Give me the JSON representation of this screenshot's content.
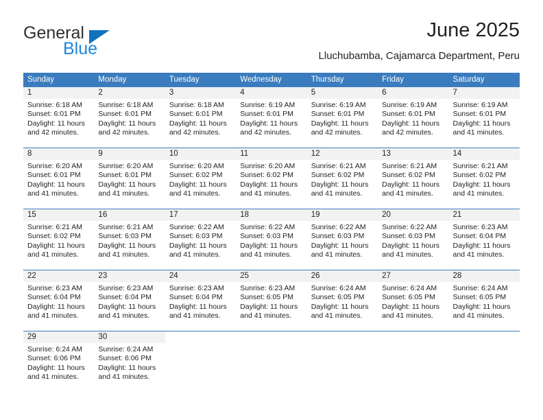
{
  "brand": {
    "name_part1": "General",
    "name_part2": "Blue"
  },
  "header": {
    "title": "June 2025",
    "subtitle": "Lluchubamba, Cajamarca Department, Peru"
  },
  "colors": {
    "header_blue": "#3a7cbe",
    "band_gray": "#f2f2f2",
    "logo_blue": "#1f86d8",
    "text": "#222222"
  },
  "weekdays": [
    "Sunday",
    "Monday",
    "Tuesday",
    "Wednesday",
    "Thursday",
    "Friday",
    "Saturday"
  ],
  "weeks": [
    [
      {
        "day": "1",
        "sunrise": "Sunrise: 6:18 AM",
        "sunset": "Sunset: 6:01 PM",
        "daylight_line1": "Daylight: 11 hours",
        "daylight_line2": "and 42 minutes."
      },
      {
        "day": "2",
        "sunrise": "Sunrise: 6:18 AM",
        "sunset": "Sunset: 6:01 PM",
        "daylight_line1": "Daylight: 11 hours",
        "daylight_line2": "and 42 minutes."
      },
      {
        "day": "3",
        "sunrise": "Sunrise: 6:18 AM",
        "sunset": "Sunset: 6:01 PM",
        "daylight_line1": "Daylight: 11 hours",
        "daylight_line2": "and 42 minutes."
      },
      {
        "day": "4",
        "sunrise": "Sunrise: 6:19 AM",
        "sunset": "Sunset: 6:01 PM",
        "daylight_line1": "Daylight: 11 hours",
        "daylight_line2": "and 42 minutes."
      },
      {
        "day": "5",
        "sunrise": "Sunrise: 6:19 AM",
        "sunset": "Sunset: 6:01 PM",
        "daylight_line1": "Daylight: 11 hours",
        "daylight_line2": "and 42 minutes."
      },
      {
        "day": "6",
        "sunrise": "Sunrise: 6:19 AM",
        "sunset": "Sunset: 6:01 PM",
        "daylight_line1": "Daylight: 11 hours",
        "daylight_line2": "and 42 minutes."
      },
      {
        "day": "7",
        "sunrise": "Sunrise: 6:19 AM",
        "sunset": "Sunset: 6:01 PM",
        "daylight_line1": "Daylight: 11 hours",
        "daylight_line2": "and 41 minutes."
      }
    ],
    [
      {
        "day": "8",
        "sunrise": "Sunrise: 6:20 AM",
        "sunset": "Sunset: 6:01 PM",
        "daylight_line1": "Daylight: 11 hours",
        "daylight_line2": "and 41 minutes."
      },
      {
        "day": "9",
        "sunrise": "Sunrise: 6:20 AM",
        "sunset": "Sunset: 6:01 PM",
        "daylight_line1": "Daylight: 11 hours",
        "daylight_line2": "and 41 minutes."
      },
      {
        "day": "10",
        "sunrise": "Sunrise: 6:20 AM",
        "sunset": "Sunset: 6:02 PM",
        "daylight_line1": "Daylight: 11 hours",
        "daylight_line2": "and 41 minutes."
      },
      {
        "day": "11",
        "sunrise": "Sunrise: 6:20 AM",
        "sunset": "Sunset: 6:02 PM",
        "daylight_line1": "Daylight: 11 hours",
        "daylight_line2": "and 41 minutes."
      },
      {
        "day": "12",
        "sunrise": "Sunrise: 6:21 AM",
        "sunset": "Sunset: 6:02 PM",
        "daylight_line1": "Daylight: 11 hours",
        "daylight_line2": "and 41 minutes."
      },
      {
        "day": "13",
        "sunrise": "Sunrise: 6:21 AM",
        "sunset": "Sunset: 6:02 PM",
        "daylight_line1": "Daylight: 11 hours",
        "daylight_line2": "and 41 minutes."
      },
      {
        "day": "14",
        "sunrise": "Sunrise: 6:21 AM",
        "sunset": "Sunset: 6:02 PM",
        "daylight_line1": "Daylight: 11 hours",
        "daylight_line2": "and 41 minutes."
      }
    ],
    [
      {
        "day": "15",
        "sunrise": "Sunrise: 6:21 AM",
        "sunset": "Sunset: 6:02 PM",
        "daylight_line1": "Daylight: 11 hours",
        "daylight_line2": "and 41 minutes."
      },
      {
        "day": "16",
        "sunrise": "Sunrise: 6:21 AM",
        "sunset": "Sunset: 6:03 PM",
        "daylight_line1": "Daylight: 11 hours",
        "daylight_line2": "and 41 minutes."
      },
      {
        "day": "17",
        "sunrise": "Sunrise: 6:22 AM",
        "sunset": "Sunset: 6:03 PM",
        "daylight_line1": "Daylight: 11 hours",
        "daylight_line2": "and 41 minutes."
      },
      {
        "day": "18",
        "sunrise": "Sunrise: 6:22 AM",
        "sunset": "Sunset: 6:03 PM",
        "daylight_line1": "Daylight: 11 hours",
        "daylight_line2": "and 41 minutes."
      },
      {
        "day": "19",
        "sunrise": "Sunrise: 6:22 AM",
        "sunset": "Sunset: 6:03 PM",
        "daylight_line1": "Daylight: 11 hours",
        "daylight_line2": "and 41 minutes."
      },
      {
        "day": "20",
        "sunrise": "Sunrise: 6:22 AM",
        "sunset": "Sunset: 6:03 PM",
        "daylight_line1": "Daylight: 11 hours",
        "daylight_line2": "and 41 minutes."
      },
      {
        "day": "21",
        "sunrise": "Sunrise: 6:23 AM",
        "sunset": "Sunset: 6:04 PM",
        "daylight_line1": "Daylight: 11 hours",
        "daylight_line2": "and 41 minutes."
      }
    ],
    [
      {
        "day": "22",
        "sunrise": "Sunrise: 6:23 AM",
        "sunset": "Sunset: 6:04 PM",
        "daylight_line1": "Daylight: 11 hours",
        "daylight_line2": "and 41 minutes."
      },
      {
        "day": "23",
        "sunrise": "Sunrise: 6:23 AM",
        "sunset": "Sunset: 6:04 PM",
        "daylight_line1": "Daylight: 11 hours",
        "daylight_line2": "and 41 minutes."
      },
      {
        "day": "24",
        "sunrise": "Sunrise: 6:23 AM",
        "sunset": "Sunset: 6:04 PM",
        "daylight_line1": "Daylight: 11 hours",
        "daylight_line2": "and 41 minutes."
      },
      {
        "day": "25",
        "sunrise": "Sunrise: 6:23 AM",
        "sunset": "Sunset: 6:05 PM",
        "daylight_line1": "Daylight: 11 hours",
        "daylight_line2": "and 41 minutes."
      },
      {
        "day": "26",
        "sunrise": "Sunrise: 6:24 AM",
        "sunset": "Sunset: 6:05 PM",
        "daylight_line1": "Daylight: 11 hours",
        "daylight_line2": "and 41 minutes."
      },
      {
        "day": "27",
        "sunrise": "Sunrise: 6:24 AM",
        "sunset": "Sunset: 6:05 PM",
        "daylight_line1": "Daylight: 11 hours",
        "daylight_line2": "and 41 minutes."
      },
      {
        "day": "28",
        "sunrise": "Sunrise: 6:24 AM",
        "sunset": "Sunset: 6:05 PM",
        "daylight_line1": "Daylight: 11 hours",
        "daylight_line2": "and 41 minutes."
      }
    ],
    [
      {
        "day": "29",
        "sunrise": "Sunrise: 6:24 AM",
        "sunset": "Sunset: 6:06 PM",
        "daylight_line1": "Daylight: 11 hours",
        "daylight_line2": "and 41 minutes."
      },
      {
        "day": "30",
        "sunrise": "Sunrise: 6:24 AM",
        "sunset": "Sunset: 6:06 PM",
        "daylight_line1": "Daylight: 11 hours",
        "daylight_line2": "and 41 minutes."
      },
      {
        "day": "",
        "sunrise": "",
        "sunset": "",
        "daylight_line1": "",
        "daylight_line2": ""
      },
      {
        "day": "",
        "sunrise": "",
        "sunset": "",
        "daylight_line1": "",
        "daylight_line2": ""
      },
      {
        "day": "",
        "sunrise": "",
        "sunset": "",
        "daylight_line1": "",
        "daylight_line2": ""
      },
      {
        "day": "",
        "sunrise": "",
        "sunset": "",
        "daylight_line1": "",
        "daylight_line2": ""
      },
      {
        "day": "",
        "sunrise": "",
        "sunset": "",
        "daylight_line1": "",
        "daylight_line2": ""
      }
    ]
  ]
}
